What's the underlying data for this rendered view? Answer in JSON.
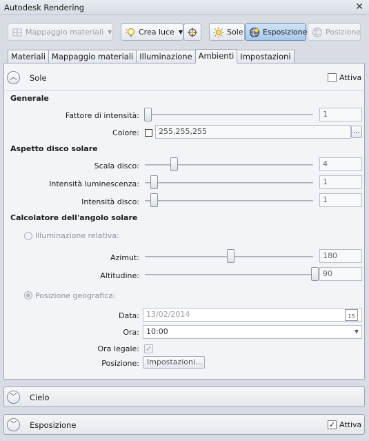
{
  "window": {
    "title": "Autodesk Rendering",
    "close": "✕"
  },
  "toolbar": {
    "material_mapping": "Mappaggio materiali",
    "create_light": "Crea luce",
    "sun": "Sole",
    "exposure": "Esposizione",
    "position": "Posizione"
  },
  "tabs": [
    "Materiali",
    "Mappaggio materiali",
    "Illuminazione",
    "Ambienti",
    "Impostazioni"
  ],
  "active_tab": "Ambienti",
  "sun_section": {
    "title": "Sole",
    "active_label": "Attiva",
    "active_checked": false,
    "general": {
      "heading": "Generale",
      "intensity_label": "Fattore di intensità:",
      "intensity_value": "1",
      "color_label": "Colore:",
      "color_value": "255,255,255",
      "browse": "..."
    },
    "disk": {
      "heading": "Aspetto disco solare",
      "scale_label": "Scala disco:",
      "scale_value": "4",
      "glow_label": "Intensità luminescenza:",
      "glow_value": "1",
      "disk_intensity_label": "Intensità disco:",
      "disk_intensity_value": "1"
    },
    "angle": {
      "heading": "Calcolatore dell'angolo solare",
      "relative_label": "Illuminazione relativa:",
      "azimuth_label": "Azimut:",
      "azimuth_value": "180",
      "altitude_label": "Altitudine:",
      "altitude_value": "90",
      "geographic_label": "Posizione geografica:",
      "date_label": "Data:",
      "date_value": "13/02/2014",
      "calendar_day": "15",
      "time_label": "Ora:",
      "time_value": "10:00",
      "dst_label": "Ora legale:",
      "dst_checked": true,
      "position_label": "Posizione:",
      "settings_button": "Impostazioni..."
    }
  },
  "sky_section": {
    "title": "Cielo"
  },
  "exposure_section": {
    "title": "Esposizione",
    "active_label": "Attiva",
    "active_checked": true
  },
  "colors": {
    "accent": "#5f89b8",
    "panel": "#f2f4f7",
    "background": "#d9dde3"
  }
}
